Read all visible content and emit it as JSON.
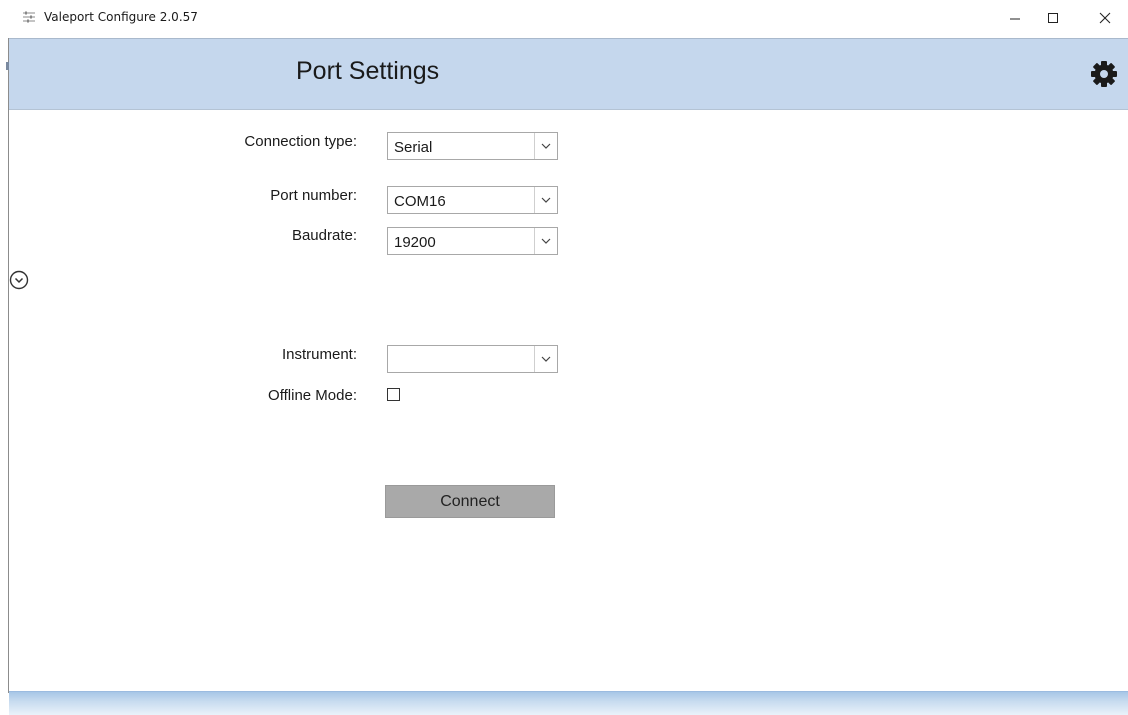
{
  "window": {
    "title": "Valeport Configure 2.0.57",
    "icon": "app-sliders-icon",
    "controls": [
      "minimize-icon",
      "maximize-icon",
      "close-icon"
    ]
  },
  "header": {
    "title": "Port Settings",
    "settings_icon": "gear-icon",
    "background_color": "#c5d7ed"
  },
  "form": {
    "connection_type": {
      "label": "Connection type:",
      "value": "Serial"
    },
    "port_number": {
      "label": "Port number:",
      "value": "COM16"
    },
    "baudrate": {
      "label": "Baudrate:",
      "value": "19200"
    },
    "instrument": {
      "label": "Instrument:",
      "value": ""
    },
    "offline_mode": {
      "label": "Offline Mode:",
      "checked": false
    },
    "connect_label": "Connect"
  },
  "side": {
    "expand_icon": "chevron-down-circle-icon"
  }
}
